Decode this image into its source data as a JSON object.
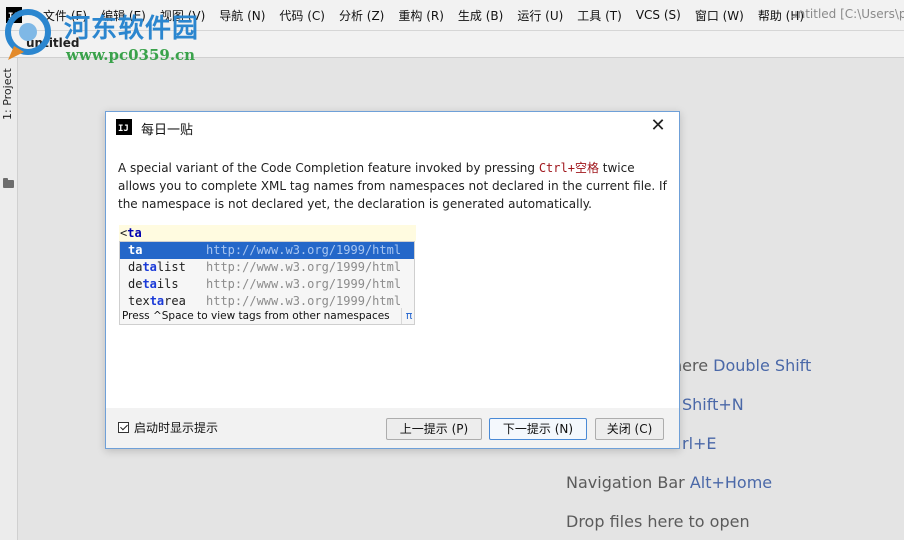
{
  "menubar": {
    "app_icon": "IJ",
    "items": [
      "文件 (F)",
      "编辑 (E)",
      "视图 (V)",
      "导航 (N)",
      "代码 (C)",
      "分析 (Z)",
      "重构 (R)",
      "生成 (B)",
      "运行 (U)",
      "工具 (T)",
      "VCS (S)",
      "窗口 (W)",
      "帮助 (H)"
    ],
    "window_title": "untitled [C:\\Users\\p"
  },
  "navbar": {
    "project_name": "untitled"
  },
  "toolstrip": {
    "project_tab": "1: Project",
    "icon": "folder-icon"
  },
  "watermark": {
    "name": "河东软件园",
    "url": "www.pc0359.cn",
    "logo_color": "#2b86cf",
    "url_color": "#3aa24b"
  },
  "editor_hints": [
    {
      "text": "here ",
      "key": "Double Shift"
    },
    {
      "text": "",
      "key": "Shift+N"
    },
    {
      "text": "",
      "key": "rl+E"
    },
    {
      "text": "Navigation Bar ",
      "key": "Alt+Home"
    },
    {
      "text": "Drop files here to open",
      "key": ""
    }
  ],
  "dialog": {
    "title": "每日一贴",
    "close_icon": "close-icon",
    "description_before": "A special variant of the Code Completion feature invoked by pressing ",
    "description_shortcut": "Ctrl+空格",
    "description_after": " twice allows you to complete XML tag names from namespaces not declared in the current file. If the namespace is not declared yet, the declaration is generated automatically.",
    "demo": {
      "bracket": "<",
      "typed": "ta",
      "suggestions": [
        {
          "pre": "",
          "hl": "ta",
          "post": "",
          "ns": "http://www.w3.org/1999/html",
          "selected": true
        },
        {
          "pre": "da",
          "hl": "ta",
          "post": "list",
          "ns": "http://www.w3.org/1999/html",
          "selected": false
        },
        {
          "pre": "de",
          "hl": "ta",
          "post": "ils",
          "ns": "http://www.w3.org/1999/html",
          "selected": false
        },
        {
          "pre": "tex",
          "hl": "ta",
          "post": "rea",
          "ns": "http://www.w3.org/1999/html",
          "selected": false
        }
      ],
      "footer": "Press ^Space to view tags from other namespaces",
      "footer_symbol": "π"
    },
    "show_on_startup_label": "启动时显示提示",
    "show_on_startup_checked": true,
    "prev_button": "上一提示 (P)",
    "next_button": "下一提示 (N)",
    "close_button": "关闭 (C)"
  }
}
